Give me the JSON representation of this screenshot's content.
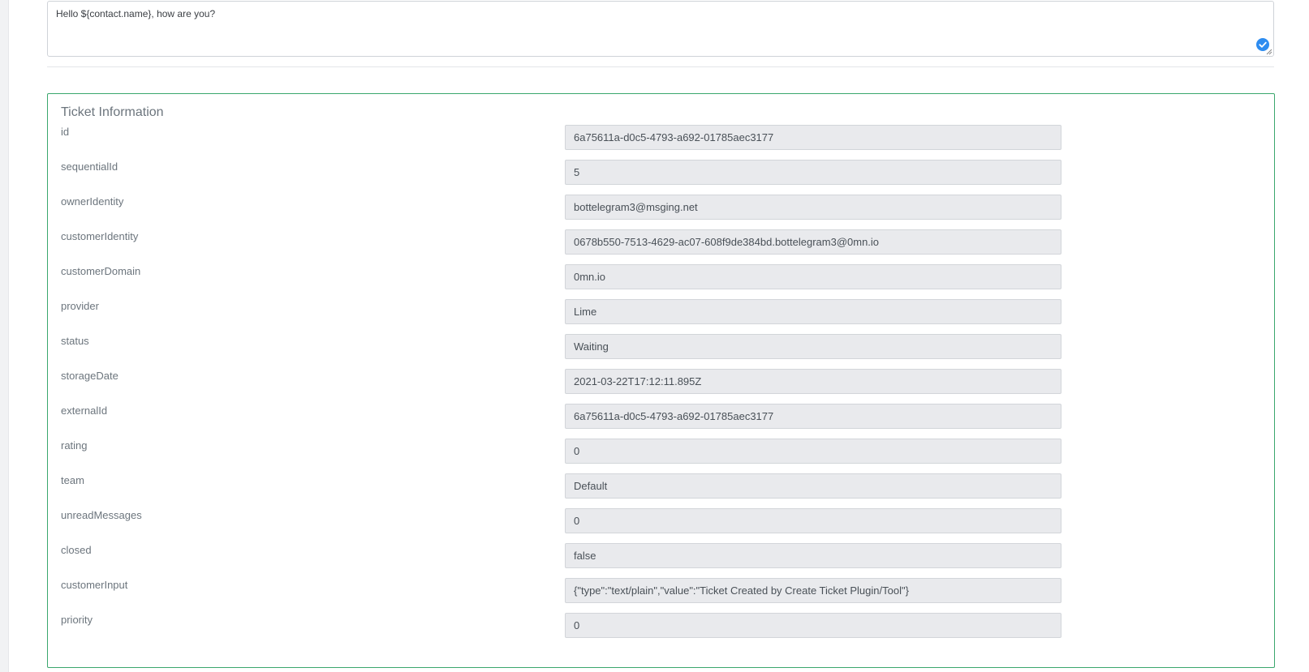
{
  "message": {
    "text": "Hello ${contact.name}, how are you?"
  },
  "ticket": {
    "title": "Ticket Information",
    "fields": [
      {
        "label": "id",
        "value": "6a75611a-d0c5-4793-a692-01785aec3177"
      },
      {
        "label": "sequentialId",
        "value": "5"
      },
      {
        "label": "ownerIdentity",
        "value": "bottelegram3@msging.net"
      },
      {
        "label": "customerIdentity",
        "value": "0678b550-7513-4629-ac07-608f9de384bd.bottelegram3@0mn.io"
      },
      {
        "label": "customerDomain",
        "value": "0mn.io"
      },
      {
        "label": "provider",
        "value": "Lime"
      },
      {
        "label": "status",
        "value": "Waiting"
      },
      {
        "label": "storageDate",
        "value": "2021-03-22T17:12:11.895Z"
      },
      {
        "label": "externalId",
        "value": "6a75611a-d0c5-4793-a692-01785aec3177"
      },
      {
        "label": "rating",
        "value": "0"
      },
      {
        "label": "team",
        "value": "Default"
      },
      {
        "label": "unreadMessages",
        "value": "0"
      },
      {
        "label": "closed",
        "value": "false"
      },
      {
        "label": "customerInput",
        "value": "{\"type\":\"text/plain\",\"value\":\"Ticket Created by Create Ticket Plugin/Tool\"}"
      },
      {
        "label": "priority",
        "value": "0"
      }
    ]
  },
  "colors": {
    "panel_border": "#3aa76d",
    "check_badge": "#2d8cf0"
  },
  "icons": {
    "check": "check-circle-icon",
    "resize": "resize-handle-icon"
  }
}
